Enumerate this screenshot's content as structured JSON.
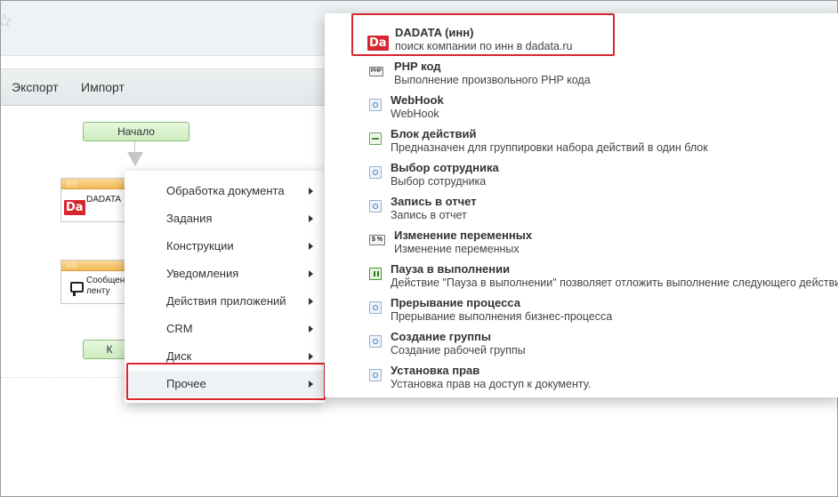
{
  "toolbar": {
    "export_label": "Экспорт",
    "import_label": "Импорт"
  },
  "workflow": {
    "start_label": "Начало",
    "end_label": "К",
    "dadata_block_label": "DADATA",
    "dadata_logo": "Da",
    "message_block_label_line1": "Сообщен",
    "message_block_label_line2": "ленту",
    "block_header_mark": "||||"
  },
  "context_menu": {
    "items": [
      {
        "label": "Обработка документа"
      },
      {
        "label": "Задания"
      },
      {
        "label": "Конструкции"
      },
      {
        "label": "Уведомления"
      },
      {
        "label": "Действия приложений"
      },
      {
        "label": "CRM"
      },
      {
        "label": "Диск"
      },
      {
        "label": "Прочее"
      }
    ],
    "active_item": "Прочее"
  },
  "submenu": {
    "items": [
      {
        "title": "DADATA (инн)",
        "desc": "поиск компании по инн в dadata.ru",
        "icon": "dadata-logo",
        "logo": "Da"
      },
      {
        "title": "PHP код",
        "desc": "Выполнение произвольного PHP кода",
        "icon": "php-icon",
        "badge": "PHP"
      },
      {
        "title": "WebHook",
        "desc": "WebHook",
        "icon": "activity-icon"
      },
      {
        "title": "Блок действий",
        "desc": "Предназначен для группировки набора действий в один блок",
        "icon": "block-icon"
      },
      {
        "title": "Выбор сотрудника",
        "desc": "Выбор сотрудника",
        "icon": "activity-icon"
      },
      {
        "title": "Запись в отчет",
        "desc": "Запись в отчет",
        "icon": "activity-icon"
      },
      {
        "title": "Изменение переменных",
        "desc": "Изменение переменных",
        "icon": "variable-icon",
        "badge": "$ %"
      },
      {
        "title": "Пауза в выполнении",
        "desc": "Действие \"Пауза в выполнении\" позволяет отложить выполнение следующего действия",
        "icon": "pause-icon"
      },
      {
        "title": "Прерывание процесса",
        "desc": "Прерывание выполнения бизнес-процесса",
        "icon": "activity-icon"
      },
      {
        "title": "Создание группы",
        "desc": "Создание рабочей группы",
        "icon": "activity-icon"
      },
      {
        "title": "Установка прав",
        "desc": "Установка прав на доступ к документу.",
        "icon": "activity-icon"
      }
    ]
  },
  "colors": {
    "highlight_frame": "#d9262f",
    "start_node": "#cdeec0",
    "block_header": "#f3b951"
  }
}
